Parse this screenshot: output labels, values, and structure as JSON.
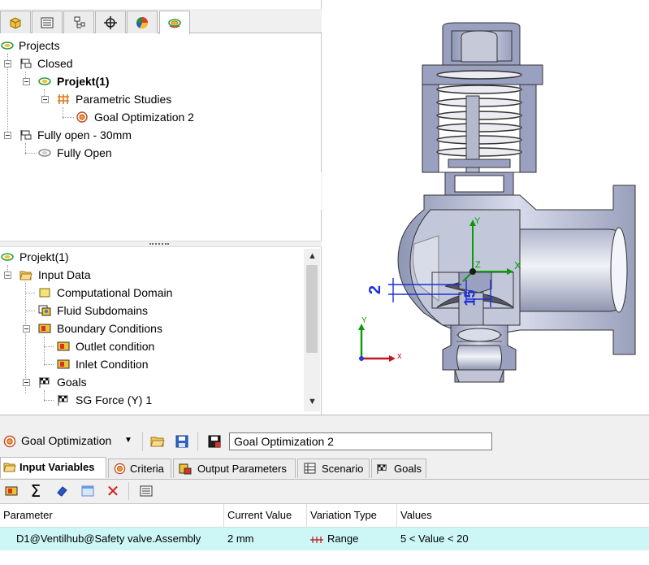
{
  "panel_tabs": [
    {
      "icon": "part-icon"
    },
    {
      "icon": "property-list-icon"
    },
    {
      "icon": "config-tree-icon"
    },
    {
      "icon": "crosshair-icon"
    },
    {
      "icon": "appearance-icon"
    },
    {
      "icon": "flow-simulation-icon"
    }
  ],
  "project_tree": {
    "root": "Projects",
    "items": [
      {
        "label": "Closed"
      },
      {
        "label": "Projekt(1)"
      },
      {
        "label": "Parametric Studies"
      },
      {
        "label": "Goal Optimization 2"
      },
      {
        "label": "Fully open - 30mm"
      },
      {
        "label": "Fully Open"
      }
    ]
  },
  "analysis_tree": {
    "root": "Projekt(1)",
    "items": [
      {
        "label": "Input Data"
      },
      {
        "label": "Computational Domain"
      },
      {
        "label": "Fluid Subdomains"
      },
      {
        "label": "Boundary Conditions"
      },
      {
        "label": "Outlet condition"
      },
      {
        "label": "Inlet Condition"
      },
      {
        "label": "Goals"
      },
      {
        "label": "SG Force (Y) 1"
      }
    ]
  },
  "viewport": {
    "dimension_labels": [
      "2",
      "15"
    ],
    "axis_labels": {
      "x": "X",
      "y": "Y",
      "z": "Z",
      "triad_x": "x",
      "triad_y": "Y"
    }
  },
  "study": {
    "type_label": "Goal Optimization",
    "name": "Goal Optimization 2",
    "tabs": [
      "Input Variables",
      "Criteria",
      "Output Parameters",
      "Scenario",
      "Goals"
    ],
    "columns": [
      "Parameter",
      "Current Value",
      "Variation Type",
      "Values"
    ],
    "rows": [
      {
        "parameter": "D1@Ventilhub@Safety valve.Assembly",
        "current_value": "2 mm",
        "variation_type": "Range",
        "values": "5 < Value < 20"
      }
    ]
  },
  "colors": {
    "selection_row": "#cdf7f7",
    "accent_red": "#cc2222",
    "axis_green": "#0a9a0a",
    "dimension_blue": "#1a2fd8"
  }
}
